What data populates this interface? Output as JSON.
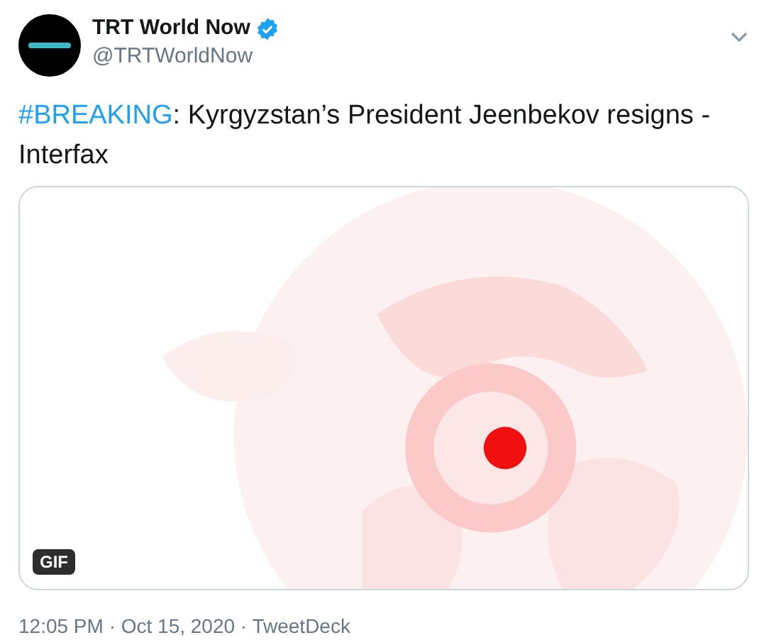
{
  "author": {
    "name": "TRT World Now",
    "verified": true,
    "handle": "@TRTWorldNow"
  },
  "tweet": {
    "hashtag": "#BREAKING",
    "text": ": Kyrgyzstan’s President Jeenbekov resigns - Interfax"
  },
  "media": {
    "kind": "picture",
    "badge": "GIF"
  },
  "footer": "12:05 PM · Oct 15, 2020 · TweetDeck"
}
